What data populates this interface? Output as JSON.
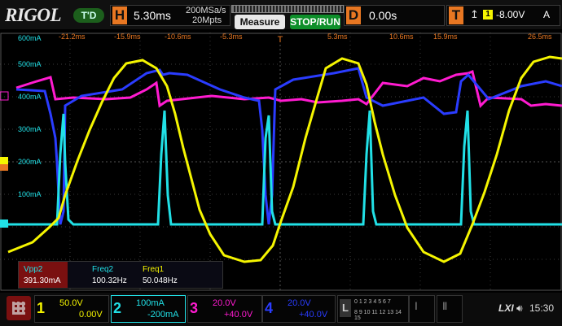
{
  "brand": "RIGOL",
  "trigger_state": "T'D",
  "horizontal": {
    "label": "H",
    "timebase": "5.30ms",
    "sample_rate": "200MSa/s",
    "memory_depth": "20Mpts"
  },
  "buttons": {
    "measure": "Measure",
    "stop_run": "STOP/RUN"
  },
  "delay": {
    "label": "D",
    "value": "0.00s"
  },
  "trigger": {
    "label": "T",
    "source_num": "1",
    "level": "-8.00V",
    "mode": "A"
  },
  "time_ticks": [
    "-21.2ms",
    "-15.9ms",
    "-10.6ms",
    "-5.3ms",
    "5.3ms",
    "10.6ms",
    "15.9ms",
    "26.5ms"
  ],
  "y_ticks": [
    "600mA",
    "500mA",
    "400mA",
    "300mA",
    "200mA",
    "100mA"
  ],
  "measurements": [
    {
      "label": "Vpp2",
      "value": "391.30mA"
    },
    {
      "label": "Freq2",
      "value": "100.32Hz"
    },
    {
      "label": "Freq1",
      "value": "50.048Hz"
    }
  ],
  "channels": [
    {
      "num": "1",
      "scale": "50.0V",
      "offset": "0.00V",
      "color": "#f5f500"
    },
    {
      "num": "2",
      "scale": "100mA",
      "offset": "-200mA",
      "color": "#21e0e6"
    },
    {
      "num": "3",
      "scale": "20.0V",
      "offset": "+40.0V",
      "color": "#ff1bd0"
    },
    {
      "num": "4",
      "scale": "20.0V",
      "offset": "+40.0V",
      "color": "#2a3cff"
    }
  ],
  "logic": {
    "label": "L",
    "bits_top": "0 1 2 3 4 5 6 7",
    "bits_bottom": "8 9 10 11 12 13 14 15"
  },
  "lxi": "LXI",
  "clock": "15:30"
}
